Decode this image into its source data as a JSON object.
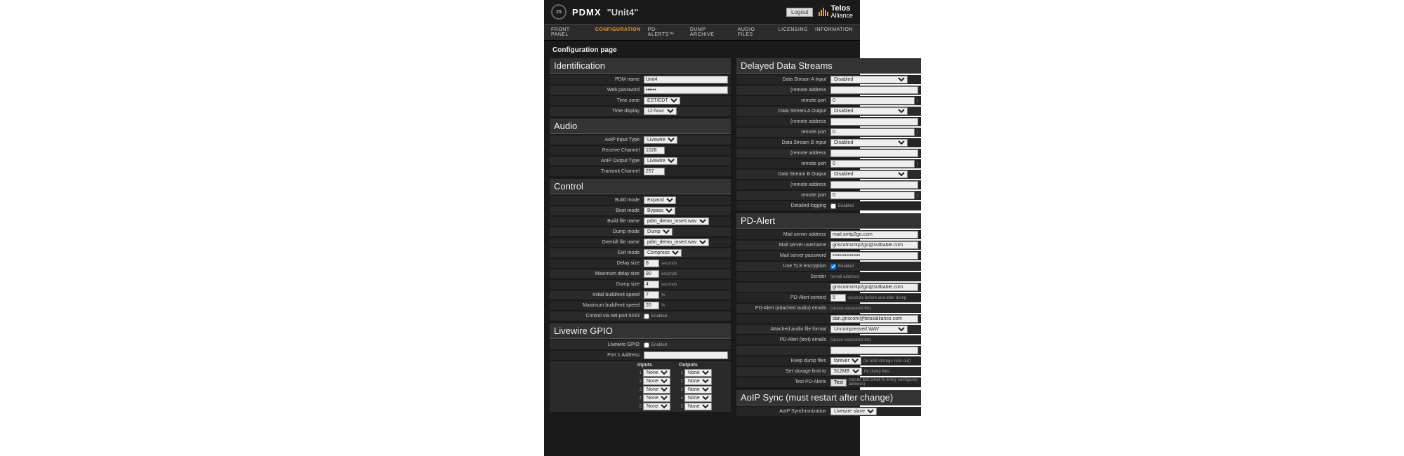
{
  "header": {
    "app": "PDMX",
    "unit": "\"Unit4\"",
    "logout": "Logout",
    "brand_top": "Telos",
    "brand_bottom": "Alliance",
    "logo_text": "25"
  },
  "nav": [
    "FRONT PANEL",
    "CONFIGURATION",
    "PD-ALERTS™",
    "DUMP ARCHIVE",
    "AUDIO FILES",
    "LICENSING",
    "INFORMATION"
  ],
  "nav_active": 1,
  "page_title": "Configuration page",
  "identification": {
    "title": "Identification",
    "pdm_name_label": "PDM name",
    "pdm_name": "Unit4",
    "web_password_label": "Web password",
    "web_password": "••••••",
    "time_zone_label": "Time zone",
    "time_zone": "EST/EDT",
    "time_display_label": "Time display",
    "time_display": "12-hour"
  },
  "audio": {
    "title": "Audio",
    "aoip_input_type_label": "AoIP Input Type",
    "aoip_input_type": "Livewire",
    "receive_channel_label": "Receive Channel",
    "receive_channel": "1028",
    "aoip_output_type_label": "AoIP Output Type",
    "aoip_output_type": "Livewire",
    "transmit_channel_label": "Transmit Channel",
    "transmit_channel": "257"
  },
  "control": {
    "title": "Control",
    "build_mode_label": "Build mode",
    "build_mode": "Expand",
    "boot_mode_label": "Boot mode",
    "boot_mode": "Bypass",
    "build_file_label": "Build file name",
    "build_file": "pdm_demo_insert.wav",
    "dump_mode_label": "Dump mode",
    "dump_mode": "Dump",
    "overkill_file_label": "Overkill file name",
    "overkill_file": "pdm_demo_insert.wav",
    "exit_mode_label": "Exit mode",
    "exit_mode": "Compress",
    "delay_size_label": "Delay size",
    "delay_size": "8",
    "max_delay_size_label": "Maximum delay size",
    "max_delay_size": "90",
    "dump_size_label": "Dump size",
    "dump_size": "4",
    "seconds": "seconds",
    "init_speed_label": "Initial build/exit speed",
    "init_speed": "7",
    "max_speed_label": "Maximum build/exit speed",
    "max_speed": "20",
    "pct": "%",
    "net_port_label": "Control via net port 5443",
    "enabled": "Enabled"
  },
  "gpio": {
    "title": "Livewire GPIO",
    "lw_gpio_label": "Livewire GPIO",
    "port1_label": "Port 1 Address",
    "port1_value": "",
    "inputs": "Inputs",
    "outputs": "Outputs",
    "option": "None"
  },
  "delayed": {
    "title": "Delayed Data Streams",
    "stream_a_in": "Data Stream A Input",
    "stream_a_out": "Data Stream A Output",
    "stream_b_in": "Data Stream B Input",
    "stream_b_out": "Data Stream B Output",
    "disabled": "Disabled",
    "remote_addr": "(remote address",
    "remote_port": "remote port",
    "zero": "0",
    "paren": ")",
    "detailed_log_label": "Detailed logging",
    "enabled": "Enabled"
  },
  "pdalert": {
    "title": "PD-Alert",
    "mail_server_label": "Mail server address",
    "mail_server": "mail.smtp2go.com",
    "mail_user_label": "Mail server username",
    "mail_user": "griscomsmtp2go@sufbable.com",
    "mail_pass_label": "Mail server password",
    "mail_pass": "••••••••••••••••",
    "tls_label": "Use TLS encryption",
    "sender_label": "Sender",
    "sender_hint": "(email address)",
    "sender": "griscomsmtp2go@sufbable.com",
    "context_label": "PD-Alert context",
    "context": "5",
    "context_unit": "seconds before and after dump",
    "audio_emails_label": "PD-Alert (attached audio) emails",
    "list_hint": "(space-separated list)",
    "audio_emails": "dan.griscom@telosalliance.com",
    "audio_fmt_label": "Attached audio file format",
    "audio_fmt": "Uncompressed WAV",
    "text_emails_label": "PD-Alert (text) emails",
    "text_emails": "",
    "keep_dump_label": "Keep dump files",
    "keep_dump": "forever",
    "keep_dump_hint": "(or until storage runs out)",
    "storage_limit_label": "Set storage limit to",
    "storage_limit": "512MB",
    "storage_limit_hint": "for dump files",
    "test_label": "Test PD-Alerts",
    "test_btn": "Test",
    "test_hint": "(sends test email to every configured address)",
    "enabled": "Enabled"
  },
  "aoip_sync": {
    "title": "AoIP Sync (must restart after change)",
    "label": "AoIP Synchronization",
    "value": "Livewire slave"
  }
}
